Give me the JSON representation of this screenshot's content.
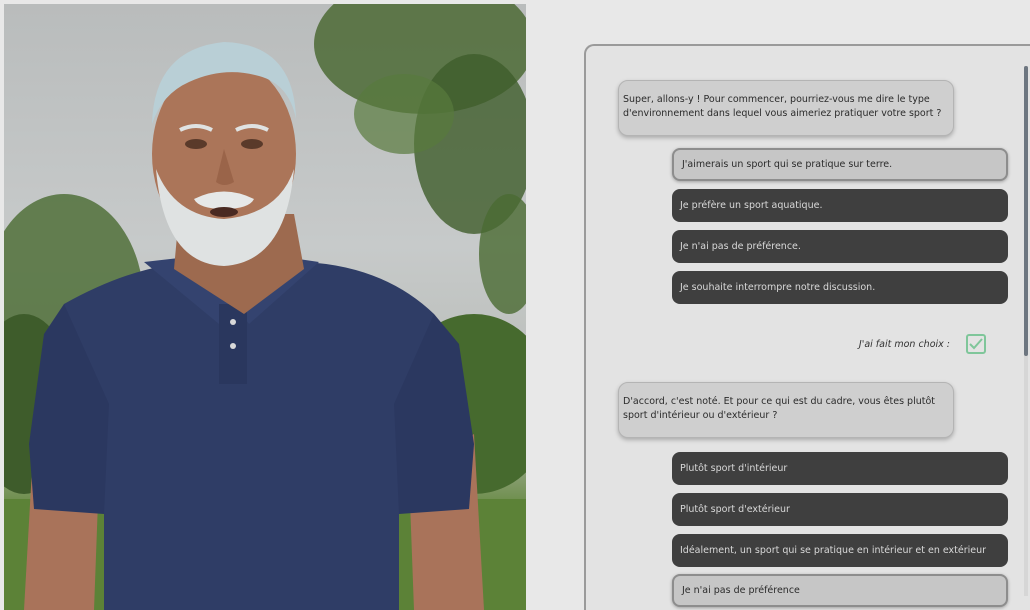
{
  "avatar": {
    "shirt_color": "#2f3d66",
    "hair_color": "#b9cfd6"
  },
  "chat": {
    "messages": [
      {
        "bot_text": "Super, allons-y ! Pour commencer, pourriez-vous me dire le type d'environnement dans lequel vous aimeriez pratiquer votre sport ?",
        "options": [
          {
            "label": "J'aimerais un sport qui se pratique sur terre.",
            "selected": true
          },
          {
            "label": "Je préfère un sport aquatique.",
            "selected": false
          },
          {
            "label": "Je n'ai pas de préférence.",
            "selected": false
          },
          {
            "label": "Je souhaite interrompre notre discussion.",
            "selected": false
          }
        ],
        "confirm_label": "J'ai fait mon choix :"
      },
      {
        "bot_text": "D'accord, c'est noté. Et pour ce qui est du cadre, vous êtes plutôt sport d'intérieur ou d'extérieur ?",
        "options": [
          {
            "label": "Plutôt sport d'intérieur",
            "selected": false
          },
          {
            "label": "Plutôt sport d'extérieur",
            "selected": false
          },
          {
            "label": "Idéalement, un sport qui se pratique en intérieur et en extérieur",
            "selected": false
          },
          {
            "label": "Je n'ai pas de préférence",
            "selected": true
          }
        ]
      }
    ]
  },
  "colors": {
    "option_dark": "#3f3f3f",
    "option_selected": "#c6c6c6",
    "check_accent": "#7fc69a"
  }
}
